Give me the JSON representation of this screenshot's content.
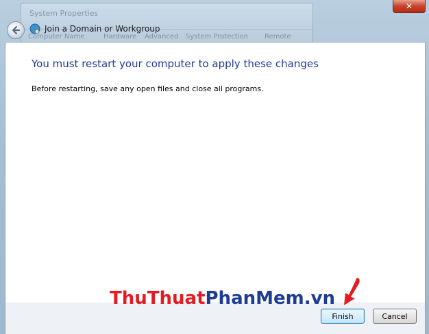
{
  "background_window": {
    "title": "System Properties",
    "tabs": [
      "Computer Name",
      "Hardware",
      "Advanced",
      "System Protection",
      "Remote"
    ]
  },
  "wizard": {
    "title": "Join a Domain or Workgroup",
    "heading": "You must restart your computer to apply these changes",
    "body": "Before restarting, save any open files and close all programs."
  },
  "buttons": {
    "finish": "Finish",
    "cancel": "Cancel",
    "close": "✕"
  },
  "watermark": {
    "part1": "Thu",
    "part2": "Thuat",
    "part3": "Phan",
    "part4": "Mem",
    "part5": ".vn"
  },
  "colors": {
    "heading": "#1f3a93",
    "watermark_red": "#e31b23",
    "watermark_blue": "#1d3c93",
    "arrow": "#e31b23"
  },
  "icons": {
    "back": "back-arrow-icon",
    "wizard": "network-globe-icon",
    "pointer": "red-arrow-icon"
  }
}
